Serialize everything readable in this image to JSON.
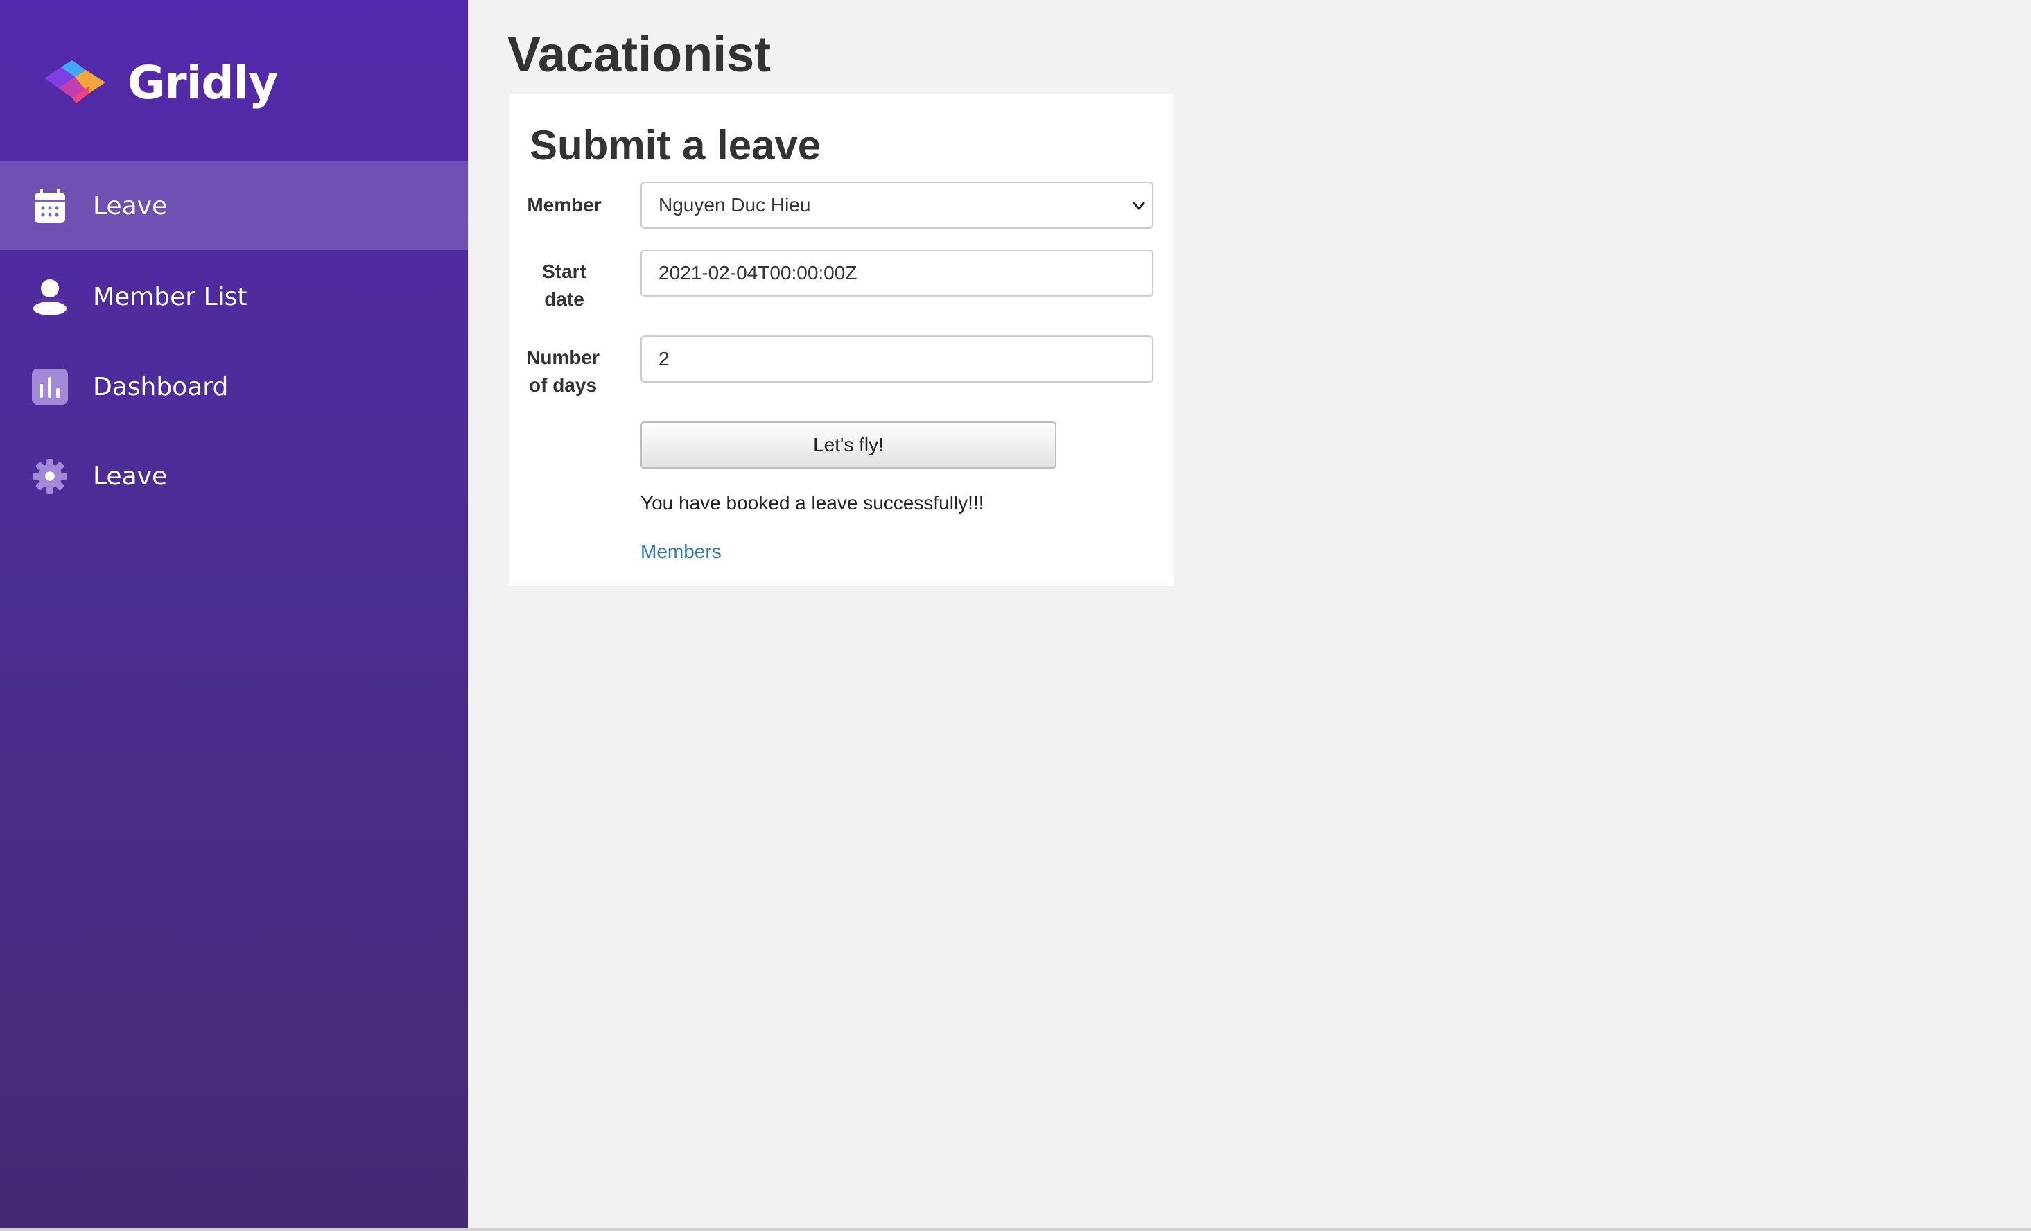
{
  "brand": {
    "name": "Gridly",
    "colors": {
      "sidebar_top": "#5429ad",
      "sidebar_bottom": "#442a73",
      "logo_blue": "#3fa9f5",
      "logo_purple": "#7b3fe4",
      "logo_orange": "#f6a53a",
      "logo_pink": "#e9457b"
    }
  },
  "sidebar": {
    "items": [
      {
        "label": "Leave",
        "icon": "calendar-icon",
        "active": true
      },
      {
        "label": "Member List",
        "icon": "user-icon",
        "active": false
      },
      {
        "label": "Dashboard",
        "icon": "bar-chart-icon",
        "active": false
      },
      {
        "label": "Leave",
        "icon": "gear-icon",
        "active": false
      }
    ]
  },
  "main": {
    "title": "Vacationist",
    "form": {
      "title": "Submit a leave",
      "member_label": "Member",
      "member_value": "Nguyen Duc Hieu",
      "start_date_label_line1": "Start",
      "start_date_label_line2": "date",
      "start_date_value": "2021-02-04T00:00:00Z",
      "days_label_line1": "Number",
      "days_label_line2": "of days",
      "days_value": "2",
      "submit_label": "Let's fly!",
      "status_message": "You have booked a leave successfully!!!",
      "members_link": "Members"
    },
    "link_color": "#337ab7"
  }
}
